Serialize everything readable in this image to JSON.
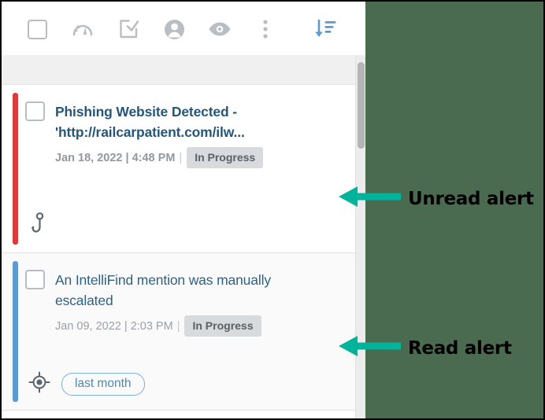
{
  "toolbar": {
    "icons": [
      {
        "name": "select-all-checkbox",
        "label": "Select all"
      },
      {
        "name": "gauge-icon",
        "label": "Severity"
      },
      {
        "name": "task-check-icon",
        "label": "Assign task"
      },
      {
        "name": "user-icon",
        "label": "Assignee"
      },
      {
        "name": "eye-icon",
        "label": "Mark as read"
      },
      {
        "name": "kebab-menu-icon",
        "label": "More options"
      }
    ],
    "sort": {
      "name": "sort-descending-icon",
      "label": "Sort"
    }
  },
  "alerts": [
    {
      "id": "unread",
      "title": "Phishing Website Detected - 'http://railcarpatient.com/ilw...",
      "date": "Jan 18, 2022",
      "time": "4:48 PM",
      "status": "In Progress",
      "type_icon": "fish-hook-icon",
      "stripe_color": "#d93c3c",
      "read": false
    },
    {
      "id": "read",
      "title": "An IntelliFind mention was manually escalated",
      "date": "Jan 09, 2022",
      "time": "2:03 PM",
      "status": "In Progress",
      "type_icon": "crosshair-target-icon",
      "tag": "last month",
      "stripe_color": "#5b9bd0",
      "read": true
    }
  ],
  "annotations": [
    {
      "label": "Unread alert",
      "arrow_color": "#00b39b"
    },
    {
      "label": "Read alert",
      "arrow_color": "#00b39b"
    }
  ],
  "colors": {
    "unread_stripe": "#d93c3c",
    "read_stripe": "#5b9bd0",
    "title_link": "#27587f",
    "badge_bg": "#d7dbde",
    "accent_sort": "#5b9bd0",
    "annotation_arrow": "#00b39b",
    "backdrop": "#4a6b50"
  }
}
